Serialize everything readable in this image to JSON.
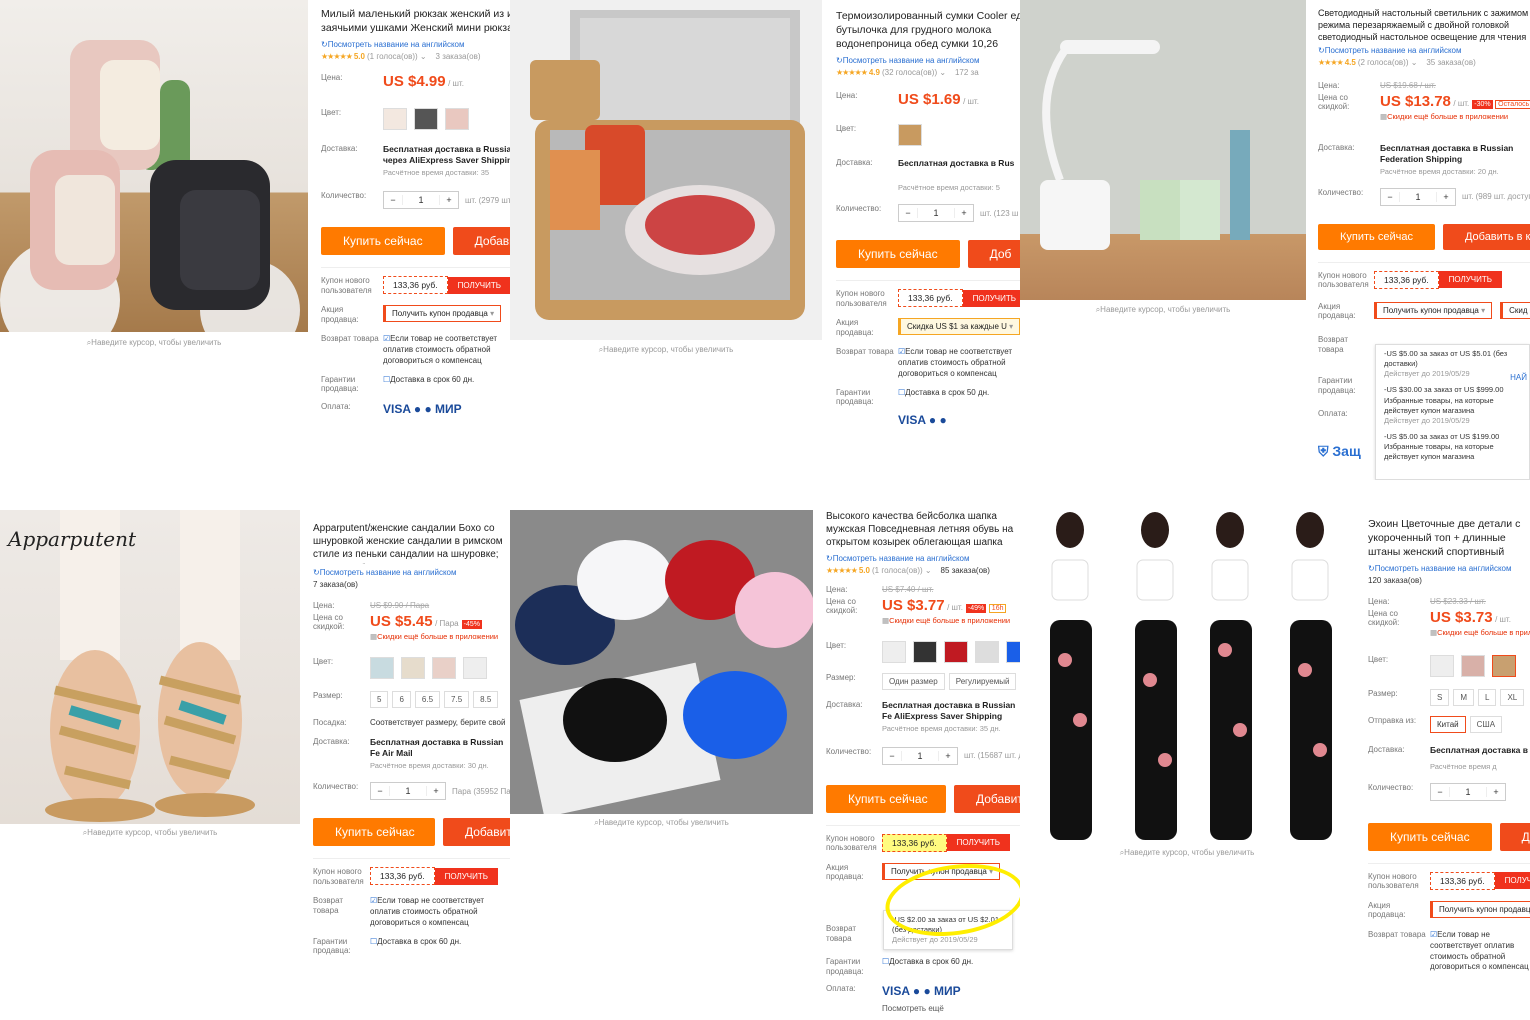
{
  "common": {
    "zoom_hint": "Наведите курсор, чтобы увеличить",
    "eng": "Посмотреть название на английском",
    "price_label": "Цена:",
    "discount_price_label": "Цена со скидкой:",
    "color_label": "Цвет:",
    "shipping_label": "Доставка:",
    "qty_label": "Количество:",
    "size_label": "Размер:",
    "buy": "Купить сейчас",
    "coupon_new_label": "Купон нового пользователя",
    "coupon_value": "133,36 руб.",
    "get": "ПОЛУЧИТЬ",
    "promo_label": "Акция продавца:",
    "get_coupon": "Получить купон продавца",
    "return_label": "Возврат товара",
    "return_text": "Если товар не соответствует оплатив стоимость обратной договориться о компенсац",
    "guarantee_label": "Гарантии продавца:",
    "payment_label": "Оплата:",
    "app_discount": "Скидки ещё больше в приложении",
    "free_ship_ru": "Бесплатная доставка в Russian Federation",
    "est_time": "Расчётное время доставки:"
  },
  "p1": {
    "title": "Милый маленький рюкзак женский из искусственной кожи с заячьими ушками Женский мини рюкзак",
    "rating": "5.0",
    "votes": "(1 голоса(ов))",
    "orders": "3 заказа(ов)",
    "price": "US $4.99",
    "unit": "/ шт.",
    "ship": "Бесплатная доставка в Russian Federation через AliExpress Saver Shipping",
    "est": "Расчётное время доставки: 35",
    "qty": "1",
    "avail": "шт. (2979 шт.",
    "add": "Добавить",
    "guarantee": "Доставка в срок 60 дн.",
    "pay": "VISA ● ● МИР"
  },
  "p2": {
    "title": "Термоизолированный сумки Cooler еда бутылочка для грудного молока водонепроница обед сумки 10,26",
    "rating": "4.9",
    "votes": "(32 голоса(ов))",
    "orders": "172 за",
    "price": "US $1.69",
    "unit": "/ шт.",
    "ship": "Бесплатная доставка в Rus",
    "est": "Расчётное время доставки: 5",
    "qty": "1",
    "avail": "шт. (123 ш",
    "add": "Доб",
    "promo": "Скидка US $1 за каждые U",
    "guarantee": "Доставка в срок 50 дн.",
    "pay": "VISA ● ●"
  },
  "p3": {
    "title": "Светодиодный настольный светильник с зажимом режима перезаряжаемый с двойной головкой светодиодный настольное освещение для чтения",
    "rating": "4.5",
    "votes": "(2 голоса(ов))",
    "orders": "35 заказа(ов)",
    "old": "US $19.68 / шт.",
    "price": "US $13.78",
    "unit": "/ шт.",
    "disc": "-30%",
    "left": "Осталось",
    "ship": "Бесплатная доставка в Russian Federation Shipping",
    "est": "Расчётное время доставки: 20 дн.",
    "qty": "1",
    "avail": "шт. (989 шт. доступно)",
    "add": "Добавить в корзину",
    "promo2": "Скид",
    "dd": [
      {
        "l1": "-US $5.00 за заказ от US $5.01 (без доставки)",
        "l2": "Действует до 2019/05/29"
      },
      {
        "l1": "-US $30.00 за заказ от US $999.00 Избранные товары, на которые действует купон магазина",
        "l2": "Действует до 2019/05/29"
      },
      {
        "l1": "-US $5.00 за заказ от US $199.00 Избранные товары, на которые действует купон магазина",
        "l2": ""
      }
    ],
    "find": "НАЙ",
    "protect": "Защ"
  },
  "p4": {
    "title": "Apparputent/женские сандалии Бохо со шнуровкой женские сандалии в римском стиле из пеньки сандалии на шнуровке; женская обувь; Мул",
    "orders": "7 заказа(ов)",
    "old": "US $9.90 / Пара",
    "price": "US $5.45",
    "unit": "/ Пара",
    "disc": "-45%",
    "sizes": [
      "5",
      "6",
      "6.5",
      "7.5",
      "8.5"
    ],
    "fit_label": "Посадка:",
    "fit": "Соответствует размеру, берите свой",
    "ship": "Бесплатная доставка в Russian Fe Air Mail",
    "est": "Расчётное время доставки: 30 дн.",
    "qty": "1",
    "avail": "Пара (35952 Пар",
    "add": "Добавить",
    "guarantee": "Доставка в срок 60 дн.",
    "brand": "Apparputent"
  },
  "p5": {
    "title": "Высокого качества бейсболка шапка мужская Повседневная летняя обувь на открытом козырек облегающая шапка черная бейс",
    "rating": "5.0",
    "votes": "(1 голоса(ов))",
    "orders": "85 заказа(ов)",
    "old": "US $7.40 / шт.",
    "price": "US $3.77",
    "unit": "/ шт.",
    "disc": "-49%",
    "timer": "16h",
    "sizes": [
      "Один размер",
      "Регулируемый"
    ],
    "ship": "Бесплатная доставка в Russian Fe AliExpress Saver Shipping",
    "est": "Расчётное время доставки: 35 дн.",
    "qty": "1",
    "avail": "шт. (15687 шт. до",
    "add": "Добавить",
    "dd": {
      "l1": "-US $2.00 за заказ от US $2.01 (без доставки)",
      "l2": "Действует до 2019/05/29"
    },
    "guarantee": "Доставка в срок 60 дн.",
    "pay": "VISA ● ● МИР",
    "more": "Посмотреть ещё"
  },
  "p6": {
    "title": "Эхоин Цветочные две детали с укороченный топ + длинные штаны женский спортивный костюм ко",
    "orders": "120 заказа(ов)",
    "old": "US $23.33 / шт.",
    "price": "US $3.73",
    "unit": "/ шт.",
    "sizes": [
      "S",
      "M",
      "L",
      "XL"
    ],
    "ship_from_label": "Отправка из:",
    "ship_from": [
      "Китай",
      "США"
    ],
    "ship": "Бесплатная доставка в",
    "est": "Расчётное время д",
    "qty": "1",
    "add": "Д"
  }
}
